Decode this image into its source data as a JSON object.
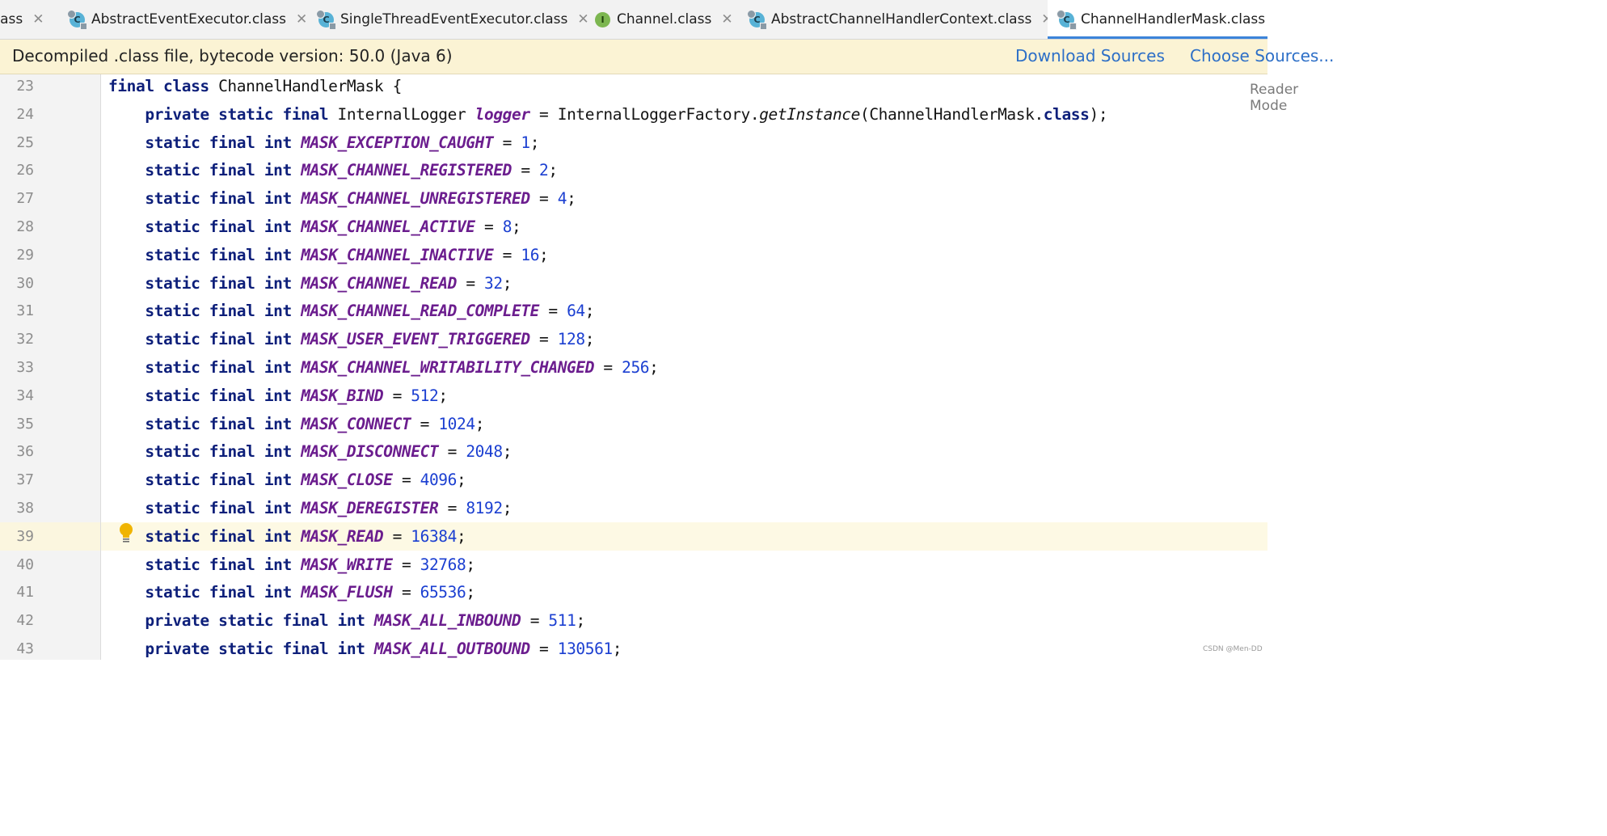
{
  "tabs": [
    {
      "label": "class",
      "icon": "class-file-icon",
      "active": false
    },
    {
      "label": "AbstractEventExecutor.class",
      "icon": "class-file-icon",
      "active": false
    },
    {
      "label": "SingleThreadEventExecutor.class",
      "icon": "class-file-icon",
      "active": false
    },
    {
      "label": "Channel.class",
      "icon": "interface-file-icon",
      "active": false
    },
    {
      "label": "AbstractChannelHandlerContext.class",
      "icon": "class-file-icon",
      "active": false
    },
    {
      "label": "ChannelHandlerMask.class",
      "icon": "class-file-icon",
      "active": true
    }
  ],
  "tab_icon_letters": {
    "class": "C",
    "interface": "I"
  },
  "close_glyph": "✕",
  "banner": {
    "message": "Decompiled .class file, bytecode version: 50.0 (Java 6)",
    "download_sources": "Download Sources",
    "choose_sources": "Choose Sources..."
  },
  "editor": {
    "reader_mode_label": "Reader Mode",
    "highlighted_line": 39,
    "lines": [
      {
        "num": "23",
        "text": "final class ChannelHandlerMask {"
      },
      {
        "num": "24",
        "text": "    private static final InternalLogger logger = InternalLoggerFactory.getInstance(ChannelHandlerMask.class);"
      },
      {
        "num": "25",
        "text": "    static final int MASK_EXCEPTION_CAUGHT = 1;"
      },
      {
        "num": "26",
        "text": "    static final int MASK_CHANNEL_REGISTERED = 2;"
      },
      {
        "num": "27",
        "text": "    static final int MASK_CHANNEL_UNREGISTERED = 4;"
      },
      {
        "num": "28",
        "text": "    static final int MASK_CHANNEL_ACTIVE = 8;"
      },
      {
        "num": "29",
        "text": "    static final int MASK_CHANNEL_INACTIVE = 16;"
      },
      {
        "num": "30",
        "text": "    static final int MASK_CHANNEL_READ = 32;"
      },
      {
        "num": "31",
        "text": "    static final int MASK_CHANNEL_READ_COMPLETE = 64;"
      },
      {
        "num": "32",
        "text": "    static final int MASK_USER_EVENT_TRIGGERED = 128;"
      },
      {
        "num": "33",
        "text": "    static final int MASK_CHANNEL_WRITABILITY_CHANGED = 256;"
      },
      {
        "num": "34",
        "text": "    static final int MASK_BIND = 512;"
      },
      {
        "num": "35",
        "text": "    static final int MASK_CONNECT = 1024;"
      },
      {
        "num": "36",
        "text": "    static final int MASK_DISCONNECT = 2048;"
      },
      {
        "num": "37",
        "text": "    static final int MASK_CLOSE = 4096;"
      },
      {
        "num": "38",
        "text": "    static final int MASK_DEREGISTER = 8192;"
      },
      {
        "num": "39",
        "text": "    static final int MASK_READ = 16384;"
      },
      {
        "num": "40",
        "text": "    static final int MASK_WRITE = 32768;"
      },
      {
        "num": "41",
        "text": "    static final int MASK_FLUSH = 65536;"
      },
      {
        "num": "42",
        "text": "    private static final int MASK_ALL_INBOUND = 511;"
      },
      {
        "num": "43",
        "text": "    private static final int MASK_ALL_OUTBOUND = 130561;"
      }
    ]
  },
  "watermark": "CSDN @Men-DD",
  "colors": {
    "keyword": "#0d1f7a",
    "field": "#6b1d8e",
    "number": "#1b3fd1",
    "active_tab_underline": "#3c84d9",
    "banner_bg": "#fbf3d4",
    "link": "#2d6fc7"
  }
}
